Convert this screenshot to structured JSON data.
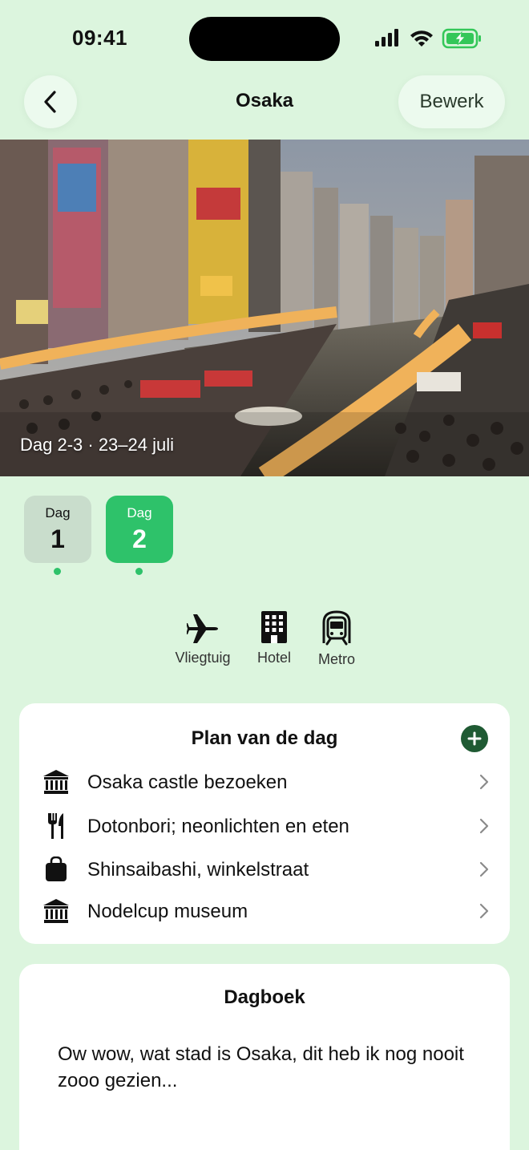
{
  "status": {
    "time": "09:41"
  },
  "nav": {
    "title": "Osaka",
    "edit_label": "Bewerk"
  },
  "hero": {
    "caption": "Dag 2-3 · 23–24 juli"
  },
  "days": [
    {
      "label": "Dag",
      "number": "1",
      "selected": false
    },
    {
      "label": "Dag",
      "number": "2",
      "selected": true
    }
  ],
  "transport": [
    {
      "label": "Vliegtuig",
      "icon": "airplane-icon"
    },
    {
      "label": "Hotel",
      "icon": "hotel-icon"
    },
    {
      "label": "Metro",
      "icon": "metro-icon"
    }
  ],
  "plan": {
    "title": "Plan van de dag",
    "items": [
      {
        "label": "Osaka castle bezoeken",
        "icon": "museum-icon"
      },
      {
        "label": "Dotonbori; neonlichten en eten",
        "icon": "fork-knife-icon"
      },
      {
        "label": "Shinsaibashi, winkelstraat",
        "icon": "shopping-bag-icon"
      },
      {
        "label": "Nodelcup museum",
        "icon": "museum-icon"
      }
    ]
  },
  "diary": {
    "title": "Dagboek",
    "text": "Ow wow, wat stad is Osaka, dit heb ik nog nooit zooo gezien..."
  },
  "colors": {
    "background": "#dcf5de",
    "accent": "#2ec26a",
    "add_button": "#1f5a33",
    "battery": "#34c759"
  }
}
